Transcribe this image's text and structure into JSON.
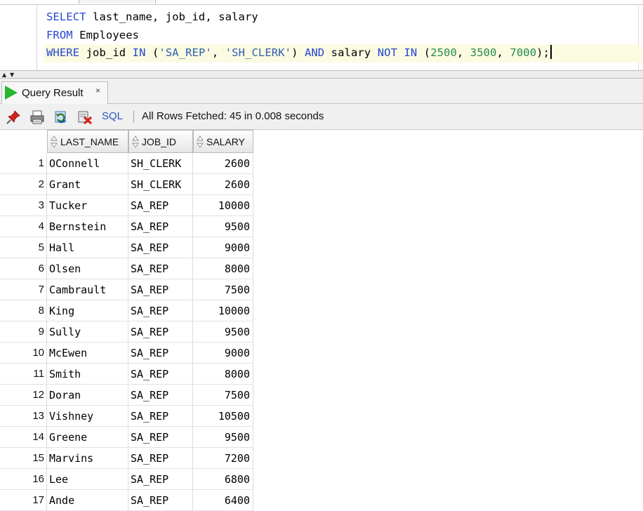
{
  "editor": {
    "lines": [
      {
        "parts": [
          {
            "t": "SELECT",
            "c": "kw"
          },
          {
            "t": " last_name, job_id, salary",
            "c": ""
          }
        ]
      },
      {
        "parts": [
          {
            "t": "FROM",
            "c": "kw"
          },
          {
            "t": " Employees",
            "c": ""
          }
        ]
      },
      {
        "parts": [
          {
            "t": "WHERE",
            "c": "kw"
          },
          {
            "t": " job_id ",
            "c": ""
          },
          {
            "t": "IN",
            "c": "kw"
          },
          {
            "t": " (",
            "c": ""
          },
          {
            "t": "'SA_REP'",
            "c": "str"
          },
          {
            "t": ", ",
            "c": ""
          },
          {
            "t": "'SH_CLERK'",
            "c": "str"
          },
          {
            "t": ") ",
            "c": ""
          },
          {
            "t": "AND",
            "c": "kw"
          },
          {
            "t": " salary ",
            "c": ""
          },
          {
            "t": "NOT",
            "c": "kw"
          },
          {
            "t": " ",
            "c": ""
          },
          {
            "t": "IN",
            "c": "kw"
          },
          {
            "t": " (",
            "c": ""
          },
          {
            "t": "2500",
            "c": "num"
          },
          {
            "t": ", ",
            "c": ""
          },
          {
            "t": "3500",
            "c": "num"
          },
          {
            "t": ", ",
            "c": ""
          },
          {
            "t": "7000",
            "c": "num"
          },
          {
            "t": ");",
            "c": ""
          }
        ],
        "current": true
      }
    ]
  },
  "result_tab": {
    "label": "Query Result",
    "close": "×"
  },
  "toolbar": {
    "icons": [
      "pin-icon",
      "print-icon",
      "refresh-icon",
      "export-icon"
    ],
    "sql_label": "SQL",
    "status": "All Rows Fetched: 45 in 0.008 seconds"
  },
  "colors": {
    "keyword": "#2545d3",
    "string": "#2f5fb1",
    "number": "#258a4f",
    "play": "#28b52f"
  },
  "table": {
    "columns": [
      "LAST_NAME",
      "JOB_ID",
      "SALARY"
    ],
    "rows": [
      [
        "1",
        "OConnell",
        "SH_CLERK",
        "2600"
      ],
      [
        "2",
        "Grant",
        "SH_CLERK",
        "2600"
      ],
      [
        "3",
        "Tucker",
        "SA_REP",
        "10000"
      ],
      [
        "4",
        "Bernstein",
        "SA_REP",
        "9500"
      ],
      [
        "5",
        "Hall",
        "SA_REP",
        "9000"
      ],
      [
        "6",
        "Olsen",
        "SA_REP",
        "8000"
      ],
      [
        "7",
        "Cambrault",
        "SA_REP",
        "7500"
      ],
      [
        "8",
        "King",
        "SA_REP",
        "10000"
      ],
      [
        "9",
        "Sully",
        "SA_REP",
        "9500"
      ],
      [
        "10",
        "McEwen",
        "SA_REP",
        "9000"
      ],
      [
        "11",
        "Smith",
        "SA_REP",
        "8000"
      ],
      [
        "12",
        "Doran",
        "SA_REP",
        "7500"
      ],
      [
        "13",
        "Vishney",
        "SA_REP",
        "10500"
      ],
      [
        "14",
        "Greene",
        "SA_REP",
        "9500"
      ],
      [
        "15",
        "Marvins",
        "SA_REP",
        "7200"
      ],
      [
        "16",
        "Lee",
        "SA_REP",
        "6800"
      ],
      [
        "17",
        "Ande",
        "SA_REP",
        "6400"
      ]
    ]
  }
}
